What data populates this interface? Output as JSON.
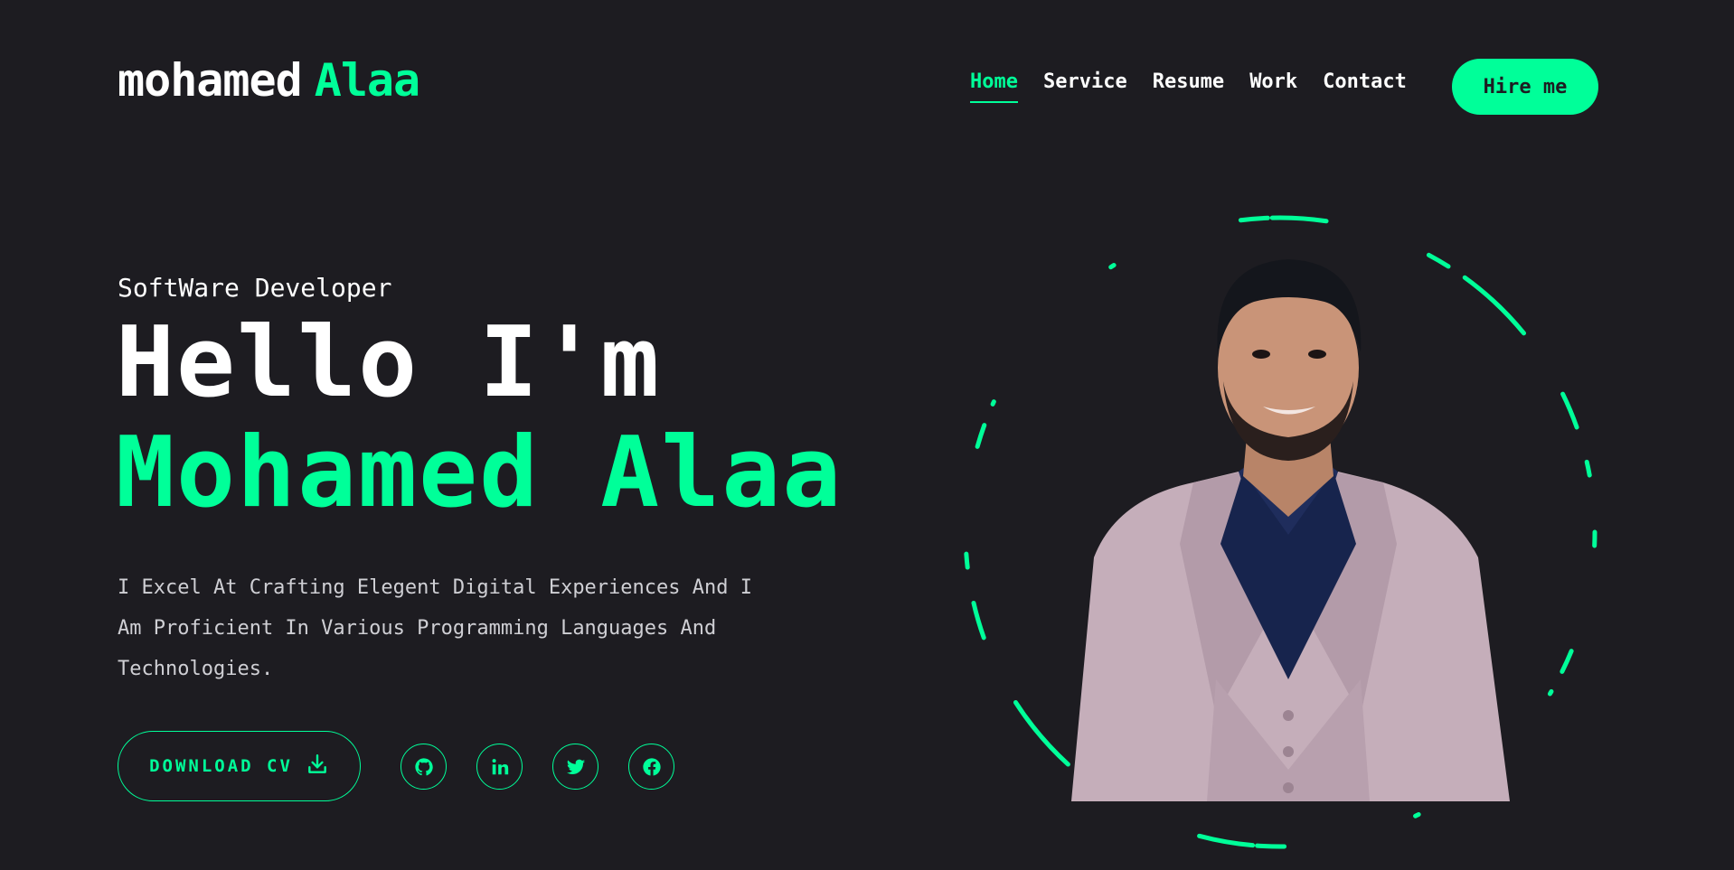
{
  "header": {
    "logo_first": "mohamed",
    "logo_second": "Alaa",
    "nav": [
      {
        "label": "Home",
        "active": true
      },
      {
        "label": "Service",
        "active": false
      },
      {
        "label": "Resume",
        "active": false
      },
      {
        "label": "Work",
        "active": false
      },
      {
        "label": "Contact",
        "active": false
      }
    ],
    "hire_label": "Hire me"
  },
  "hero": {
    "subtitle": "SoftWare Developer",
    "greeting": "Hello I'm",
    "name": "Mohamed Alaa",
    "description": "I Excel At Crafting Elegent Digital Experiences And I Am Proficient In Various Programming Languages And Technologies.",
    "download_label": "DOWNLOAD CV",
    "download_icon": "download-icon",
    "socials": [
      {
        "icon": "github-icon"
      },
      {
        "icon": "linkedin-icon"
      },
      {
        "icon": "twitter-icon"
      },
      {
        "icon": "facebook-icon"
      }
    ]
  },
  "colors": {
    "background": "#1d1c21",
    "accent": "#00ff99",
    "text": "#ffffff"
  },
  "portrait": {
    "image": "profile-photo",
    "ring": "dashed-rotating-ring"
  }
}
